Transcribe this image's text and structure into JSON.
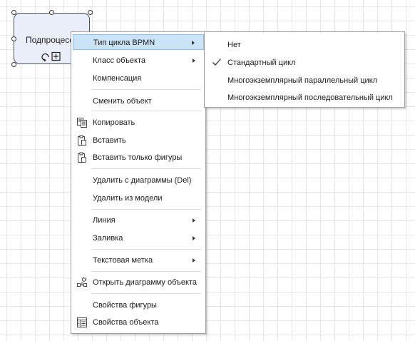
{
  "shape": {
    "label": "Подпроцесс"
  },
  "context_menu": {
    "items": [
      {
        "label": "Тип цикла BPMN",
        "submenu": true
      },
      {
        "label": "Класс объекта",
        "submenu": true
      },
      {
        "label": "Компенсация"
      },
      {
        "label": "Сменить объект"
      },
      {
        "label": "Копировать",
        "icon": "copy-icon"
      },
      {
        "label": "Вставить",
        "icon": "paste-icon"
      },
      {
        "label": "Вставить только фигуры",
        "icon": "paste-shapes-icon"
      },
      {
        "label": "Удалить с диаграммы (Del)"
      },
      {
        "label": "Удалить из модели"
      },
      {
        "label": "Линия",
        "submenu": true
      },
      {
        "label": "Заливка",
        "submenu": true
      },
      {
        "label": "Текстовая метка",
        "submenu": true
      },
      {
        "label": "Открыть диаграмму объекта",
        "icon": "object-diagram-icon"
      },
      {
        "label": "Свойства фигуры"
      },
      {
        "label": "Свойства объекта",
        "icon": "properties-icon"
      }
    ]
  },
  "submenu": {
    "items": [
      {
        "label": "Нет"
      },
      {
        "label": "Стандартный цикл",
        "checked": true
      },
      {
        "label": "Многоэкземплярный параллельный цикл"
      },
      {
        "label": "Многоэкземплярный последовательный цикл"
      }
    ]
  },
  "colors": {
    "selection": "#cbe3f7",
    "shape_fill": "#eaeef9"
  }
}
